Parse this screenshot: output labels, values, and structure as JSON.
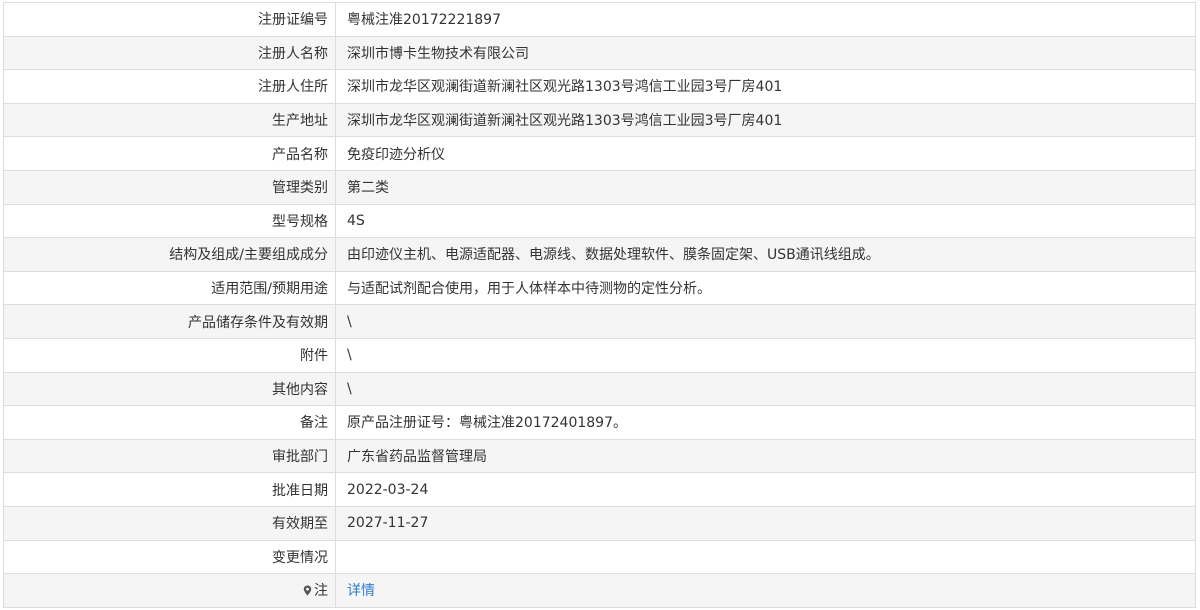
{
  "rows": [
    {
      "label": "注册证编号",
      "value": "粤械注准20172221897"
    },
    {
      "label": "注册人名称",
      "value": "深圳市博卡生物技术有限公司"
    },
    {
      "label": "注册人住所",
      "value": "深圳市龙华区观澜街道新澜社区观光路1303号鸿信工业园3号厂房401"
    },
    {
      "label": "生产地址",
      "value": "深圳市龙华区观澜街道新澜社区观光路1303号鸿信工业园3号厂房401"
    },
    {
      "label": "产品名称",
      "value": "免疫印迹分析仪"
    },
    {
      "label": "管理类别",
      "value": "第二类"
    },
    {
      "label": "型号规格",
      "value": "4S"
    },
    {
      "label": "结构及组成/主要组成成分",
      "value": "由印迹仪主机、电源适配器、电源线、数据处理软件、膜条固定架、USB通讯线组成。"
    },
    {
      "label": "适用范围/预期用途",
      "value": "与适配试剂配合使用，用于人体样本中待测物的定性分析。"
    },
    {
      "label": "产品储存条件及有效期",
      "value": "\\"
    },
    {
      "label": "附件",
      "value": "\\"
    },
    {
      "label": "其他内容",
      "value": "\\"
    },
    {
      "label": "备注",
      "value": "原产品注册证号：粤械注准20172401897。"
    },
    {
      "label": "审批部门",
      "value": "广东省药品监督管理局"
    },
    {
      "label": "批准日期",
      "value": "2022-03-24"
    },
    {
      "label": "有效期至",
      "value": "2027-11-27"
    },
    {
      "label": "变更情况",
      "value": ""
    }
  ],
  "note_row": {
    "icon": "map-pin-icon",
    "label": "注",
    "link_text": "详情"
  }
}
